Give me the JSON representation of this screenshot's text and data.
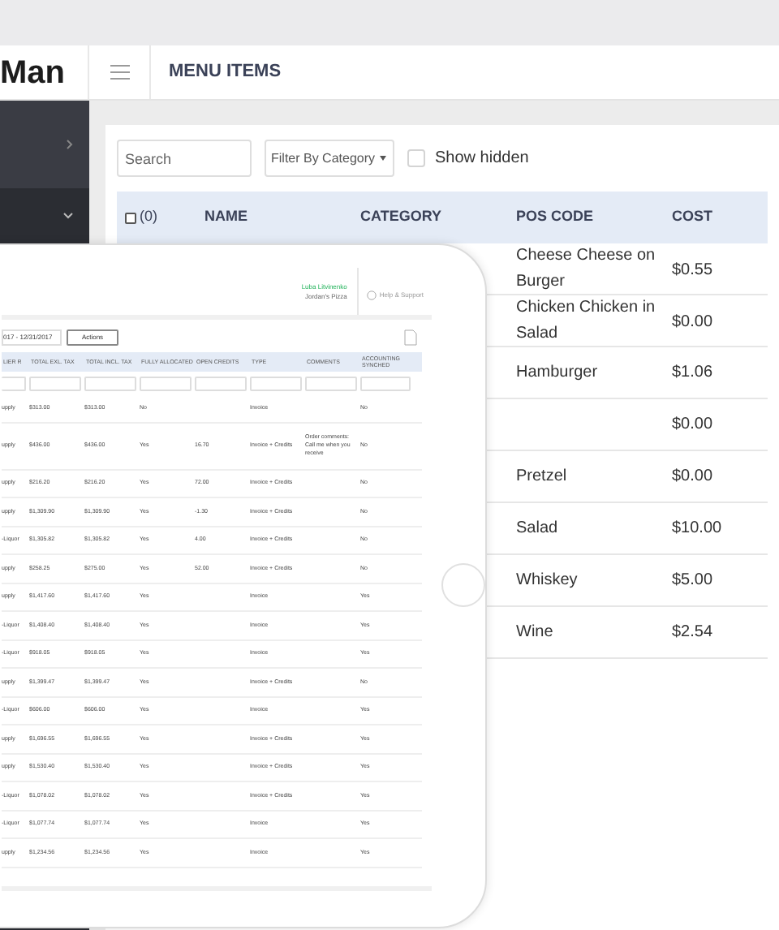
{
  "header": {
    "logo": "Man",
    "page_title": "MENU ITEMS"
  },
  "sidebar": {
    "items": [
      {
        "selected": false,
        "expanded": false
      },
      {
        "selected": true,
        "expanded": true
      }
    ]
  },
  "toolbar": {
    "search": {
      "placeholder": "Search"
    },
    "filter": {
      "label": "Filter By Category"
    },
    "show_hidden": {
      "label": "Show hidden",
      "checked": false
    }
  },
  "menu_table": {
    "select_all": {
      "label": "(0)",
      "checked": false
    },
    "columns": [
      "NAME",
      "CATEGORY",
      "POS CODE",
      "COST"
    ],
    "rows": [
      {
        "pos_code": "Cheese Cheese on Burger",
        "cost": "$0.55"
      },
      {
        "pos_code": "Chicken Chicken in Salad",
        "cost": "$0.00"
      },
      {
        "pos_code": "Hamburger",
        "cost": "$1.06"
      },
      {
        "cost": "$0.00"
      },
      {
        "pos_code": "Pretzel",
        "cost": "$0.00"
      },
      {
        "pos_code": "Salad",
        "cost": "$10.00"
      },
      {
        "pos_code": "Whiskey",
        "cost": "$5.00"
      },
      {
        "pos_code": "Wine",
        "cost": "$2.54"
      }
    ]
  },
  "tablet": {
    "user": {
      "name": "Luba Litvinenko",
      "company": "Jordan's Pizza"
    },
    "help": "Help & Support",
    "date_range": "017 - 12/31/2017",
    "actions": "Actions",
    "columns": [
      "LIER R",
      "TOTAL EXL. TAX",
      "TOTAL INCL. TAX",
      "FULLY ALLOCATED",
      "OPEN CREDITS",
      "TYPE",
      "COMMENTS",
      "ACCOUNTING SYNCHED"
    ],
    "rows": [
      {
        "supplier": "upply",
        "total_excl": "$313.00",
        "total_incl": "$313.00",
        "allocated": "No",
        "type": "Invoice",
        "synched": "No"
      },
      {
        "supplier": "upply",
        "total_excl": "$436.00",
        "total_incl": "$436.00",
        "allocated": "Yes",
        "open_credits": "16.70",
        "type": "Invoice + Credits",
        "comments": "Order comments: Call me when you receive",
        "synched": "No"
      },
      {
        "supplier": "upply",
        "total_excl": "$216.20",
        "total_incl": "$216.20",
        "allocated": "Yes",
        "open_credits": "72.00",
        "type": "Invoice + Credits",
        "synched": "No"
      },
      {
        "supplier": "upply",
        "total_excl": "$1,309.90",
        "total_incl": "$1,309.90",
        "allocated": "Yes",
        "open_credits": "-1.30",
        "type": "Invoice + Credits",
        "synched": "No"
      },
      {
        "supplier": "-Liquor",
        "total_excl": "$1,305.82",
        "total_incl": "$1,305.82",
        "allocated": "Yes",
        "open_credits": "4.00",
        "type": "Invoice + Credits",
        "synched": "No"
      },
      {
        "supplier": "upply",
        "total_excl": "$258.25",
        "total_incl": "$275.00",
        "allocated": "Yes",
        "open_credits": "52.00",
        "type": "Invoice + Credits",
        "synched": "No"
      },
      {
        "supplier": "upply",
        "total_excl": "$1,417.60",
        "total_incl": "$1,417.60",
        "allocated": "Yes",
        "type": "Invoice",
        "synched": "Yes"
      },
      {
        "supplier": "-Liquor",
        "total_excl": "$1,408.40",
        "total_incl": "$1,408.40",
        "allocated": "Yes",
        "type": "Invoice",
        "synched": "Yes"
      },
      {
        "supplier": "-Liquor",
        "total_excl": "$918.05",
        "total_incl": "$918.05",
        "allocated": "Yes",
        "type": "Invoice",
        "synched": "Yes"
      },
      {
        "supplier": "upply",
        "total_excl": "$1,399.47",
        "total_incl": "$1,399.47",
        "allocated": "Yes",
        "type": "Invoice + Credits",
        "synched": "No"
      },
      {
        "supplier": "-Liquor",
        "total_excl": "$606.00",
        "total_incl": "$606.00",
        "allocated": "Yes",
        "type": "Invoice",
        "synched": "Yes"
      },
      {
        "supplier": "upply",
        "total_excl": "$1,696.55",
        "total_incl": "$1,696.55",
        "allocated": "Yes",
        "type": "Invoice + Credits",
        "synched": "Yes"
      },
      {
        "supplier": "upply",
        "total_excl": "$1,530.40",
        "total_incl": "$1,530.40",
        "allocated": "Yes",
        "type": "Invoice + Credits",
        "synched": "Yes"
      },
      {
        "supplier": "-Liquor",
        "total_excl": "$1,078.02",
        "total_incl": "$1,078.02",
        "allocated": "Yes",
        "type": "Invoice + Credits",
        "synched": "Yes"
      },
      {
        "supplier": "-Liquor",
        "total_excl": "$1,077.74",
        "total_incl": "$1,077.74",
        "allocated": "Yes",
        "type": "Invoice",
        "synched": "Yes"
      },
      {
        "supplier": "upply",
        "total_excl": "$1,234.56",
        "total_incl": "$1,234.56",
        "allocated": "Yes",
        "type": "Invoice",
        "synched": "Yes"
      }
    ]
  }
}
